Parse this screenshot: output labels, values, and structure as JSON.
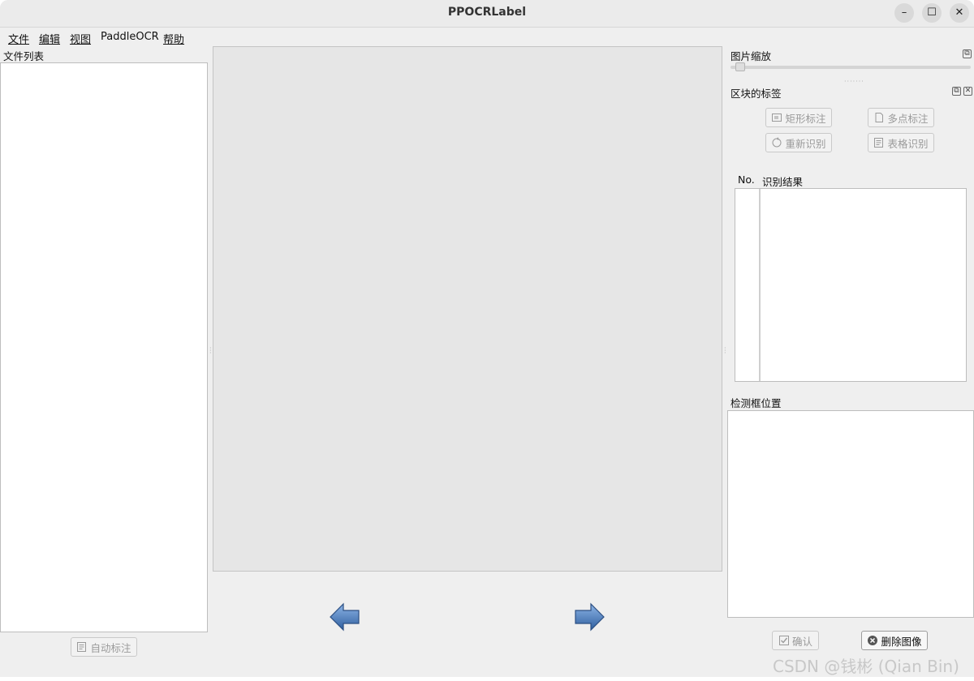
{
  "window": {
    "title": "PPOCRLabel"
  },
  "window_controls": {
    "minimize": "–",
    "maximize": "☐",
    "close": "✕"
  },
  "menu": [
    {
      "label": "文件",
      "mnemonic_char": "文"
    },
    {
      "label": "编辑",
      "mnemonic_char": "编"
    },
    {
      "label": "视图",
      "mnemonic_char": "视"
    },
    {
      "label": "PaddleOCR",
      "mnemonic_char": "P"
    },
    {
      "label": "帮助",
      "mnemonic_char": "帮"
    }
  ],
  "file_panel": {
    "title": "文件列表",
    "auto_label_button": "自动标注"
  },
  "zoom_panel": {
    "title": "图片缩放",
    "zoom_fraction": 0.02
  },
  "block_panel": {
    "title": "区块的标签",
    "buttons": {
      "rect": "矩形标注",
      "poly": "多点标注",
      "rerecognize": "重新识别",
      "table": "表格识别"
    },
    "columns": {
      "no": "No.",
      "result": "识别结果"
    }
  },
  "bbox_panel": {
    "title": "检测框位置"
  },
  "actions": {
    "confirm": "确认",
    "delete_image": "删除图像"
  },
  "watermark": "CSDN @钱彬 (Qian Bin)",
  "colors": {
    "arrow_blue": "#3f6fb0",
    "canvas_bg": "#e6e6e6",
    "window_bg": "#efefef"
  },
  "icons": {
    "prev": "left-arrow-icon",
    "next": "right-arrow-icon"
  }
}
